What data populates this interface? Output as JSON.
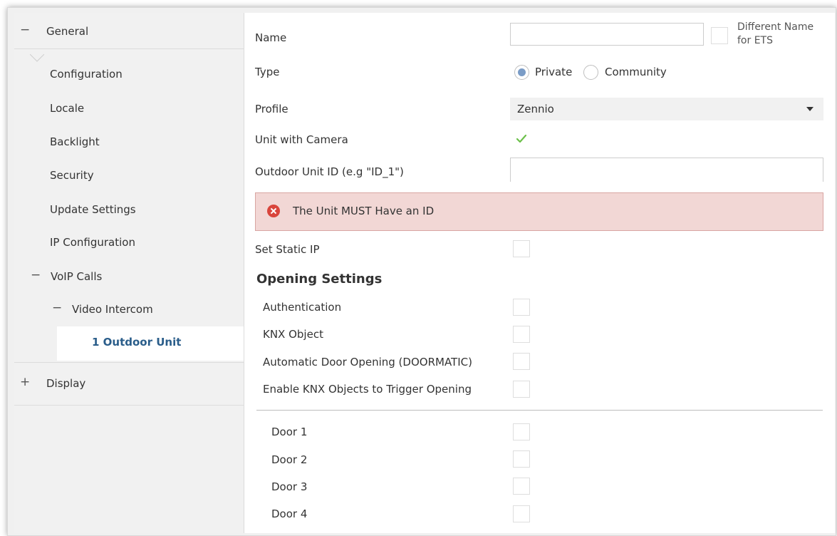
{
  "sidebar": {
    "general": {
      "sign": "−",
      "label": "General"
    },
    "items": [
      {
        "label": "Configuration"
      },
      {
        "label": "Locale"
      },
      {
        "label": "Backlight"
      },
      {
        "label": "Security"
      },
      {
        "label": "Update Settings"
      },
      {
        "label": "IP Configuration"
      }
    ],
    "voip": {
      "sign": "−",
      "label": "VoIP Calls"
    },
    "video_intercom": {
      "sign": "−",
      "label": "Video Intercom"
    },
    "active_item": {
      "label": "1 Outdoor Unit"
    },
    "display": {
      "sign": "+",
      "label": "Display"
    }
  },
  "form": {
    "name": {
      "label": "Name",
      "value": "",
      "different_name_label": "Different Name for ETS"
    },
    "type": {
      "label": "Type",
      "options": [
        "Private",
        "Community"
      ],
      "selected": "Private"
    },
    "profile": {
      "label": "Profile",
      "value": "Zennio"
    },
    "camera": {
      "label": "Unit with Camera",
      "checked": true
    },
    "outdoor_id": {
      "label": "Outdoor Unit ID (e.g \"ID_1\")",
      "value": ""
    },
    "error": {
      "text": "The Unit MUST Have an ID"
    },
    "static_ip": {
      "label": "Set Static IP"
    },
    "opening": {
      "title": "Opening Settings",
      "items": [
        {
          "label": "Authentication"
        },
        {
          "label": "KNX Object"
        },
        {
          "label": "Automatic Door Opening (DOORMATIC)"
        },
        {
          "label": "Enable KNX Objects to Trigger Opening"
        }
      ]
    },
    "doors": [
      {
        "label": "Door 1"
      },
      {
        "label": "Door 2"
      },
      {
        "label": "Door 3"
      },
      {
        "label": "Door 4"
      }
    ]
  },
  "colors": {
    "accent": "#2a5d8a",
    "error_bg": "#f2d7d5",
    "error_icon": "#d9453c",
    "check": "#6cc04a",
    "radio": "#7a9cc6"
  },
  "icons": {
    "error": "error-circle-x-icon",
    "check": "checkmark-icon",
    "dropdown": "chevron-down-icon"
  }
}
